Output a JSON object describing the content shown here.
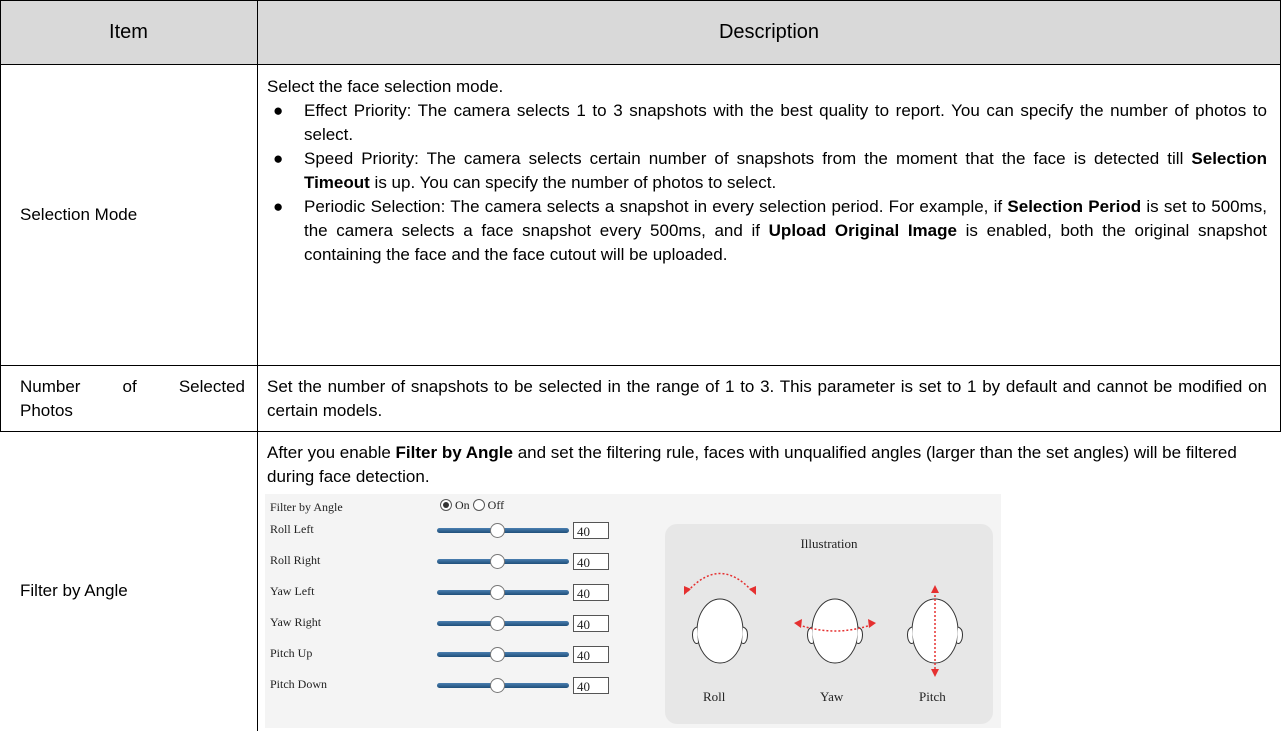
{
  "header": {
    "item": "Item",
    "description": "Description"
  },
  "rows": {
    "selection_mode": {
      "item": "Selection Mode",
      "intro": "Select the face selection mode.",
      "bullet_char": "●",
      "b1": "Effect Priority: The camera selects 1 to 3 snapshots with the best quality to report. You can specify the number of photos to select.",
      "b2_a": "Speed Priority: The camera selects certain number of snapshots from the moment that the face is detected till ",
      "b2_bold": "Selection Timeout",
      "b2_b": " is up. You can specify the number of photos to select.",
      "b3_a": "Periodic Selection: The camera selects a snapshot in every selection period. For example, if ",
      "b3_bold1": "Selection Period",
      "b3_b": " is set to 500ms, the camera selects a face snapshot every 500ms, and if ",
      "b3_bold2": "Upload Original Image",
      "b3_c": " is enabled, both the original snapshot containing the face and the face cutout will be uploaded."
    },
    "number_selected": {
      "item_line1": "Number of Selected",
      "item_line2": "Photos",
      "desc": "Set the number of snapshots to be selected in the range of 1 to 3. This parameter is set to 1 by default and cannot be modified on certain models."
    },
    "filter_angle": {
      "item": "Filter by Angle",
      "desc_a": "After you enable ",
      "desc_bold": "Filter by Angle",
      "desc_b": " and set the filtering rule, faces with unqualified angles (larger than the set angles) will be filtered during face detection."
    }
  },
  "screenshot": {
    "toggle_label": "Filter by Angle",
    "on": "On",
    "off": "Off",
    "selected": "On",
    "sliders": [
      {
        "label": "Roll Left",
        "value": "40"
      },
      {
        "label": "Roll Right",
        "value": "40"
      },
      {
        "label": "Yaw Left",
        "value": "40"
      },
      {
        "label": "Yaw Right",
        "value": "40"
      },
      {
        "label": "Pitch Up",
        "value": "40"
      },
      {
        "label": "Pitch Down",
        "value": "40"
      }
    ],
    "illustration_title": "Illustration",
    "faces": [
      "Roll",
      "Yaw",
      "Pitch"
    ],
    "colors": {
      "slider": "#2f6a9a",
      "arrow": "#e53030"
    }
  }
}
